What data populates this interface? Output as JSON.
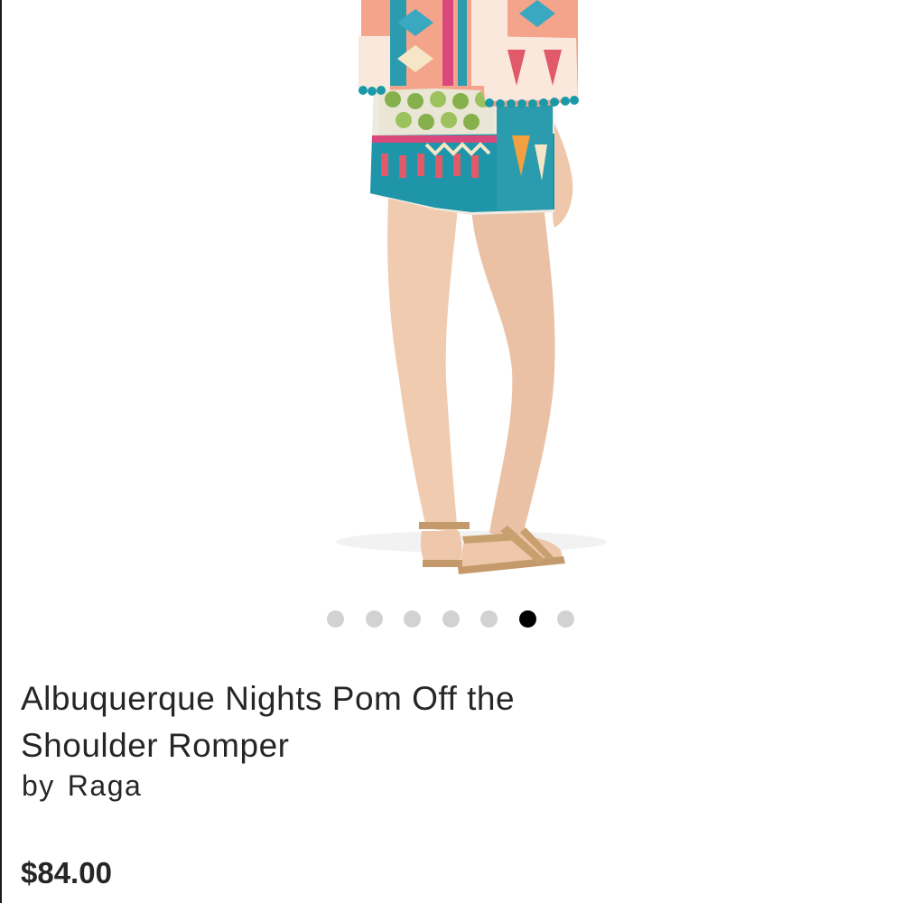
{
  "product": {
    "title": "Albuquerque Nights Pom Off the Shoulder Romper",
    "by_label": "by",
    "brand": "Raga",
    "price": "$84.00"
  },
  "carousel": {
    "total_images": 7,
    "active_index": 5
  },
  "colors": {
    "text": "#262626",
    "dot_inactive": "#d2d2d2",
    "dot_active": "#000000",
    "pom_teal": "#1a9aa8",
    "print_coral": "#f08a6a"
  }
}
